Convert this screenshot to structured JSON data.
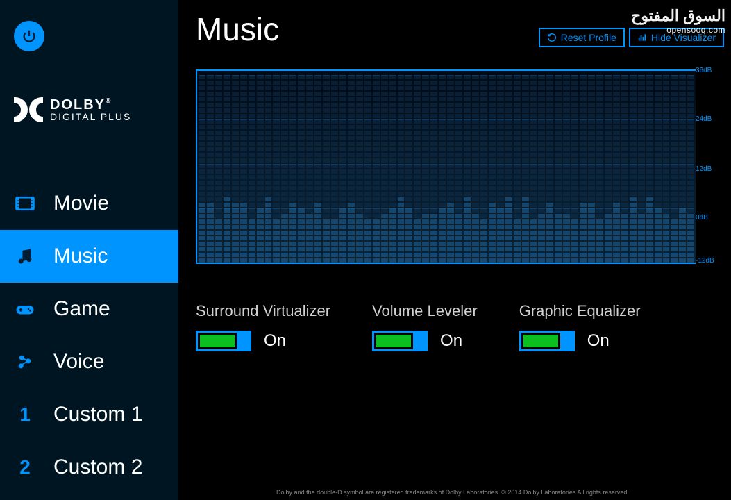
{
  "brand": {
    "line1": "DOLBY",
    "line2": "DIGITAL PLUS"
  },
  "nav": {
    "items": [
      {
        "label": "Movie",
        "icon": "movie-icon",
        "num": ""
      },
      {
        "label": "Music",
        "icon": "music-icon",
        "num": ""
      },
      {
        "label": "Game",
        "icon": "game-icon",
        "num": ""
      },
      {
        "label": "Voice",
        "icon": "voice-icon",
        "num": ""
      },
      {
        "label": "Custom 1",
        "icon": "num1-icon",
        "num": "1"
      },
      {
        "label": "Custom 2",
        "icon": "num2-icon",
        "num": "2"
      }
    ],
    "active_index": 1
  },
  "page": {
    "title": "Music",
    "reset_label": "Reset Profile",
    "hide_label": "Hide Visualizer"
  },
  "visualizer": {
    "scale": [
      "36dB",
      "24dB",
      "12dB",
      "0dB",
      "-12dB"
    ]
  },
  "controls": [
    {
      "label": "Surround Virtualizer",
      "state": "On"
    },
    {
      "label": "Volume Leveler",
      "state": "On"
    },
    {
      "label": "Graphic Equalizer",
      "state": "On"
    }
  ],
  "footer": "Dolby and the double-D symbol are registered trademarks of Dolby Laboratories. © 2014 Dolby Laboratories All rights reserved.",
  "watermark": {
    "ar": "السوق المفتوح",
    "en": "opensooq.com"
  }
}
